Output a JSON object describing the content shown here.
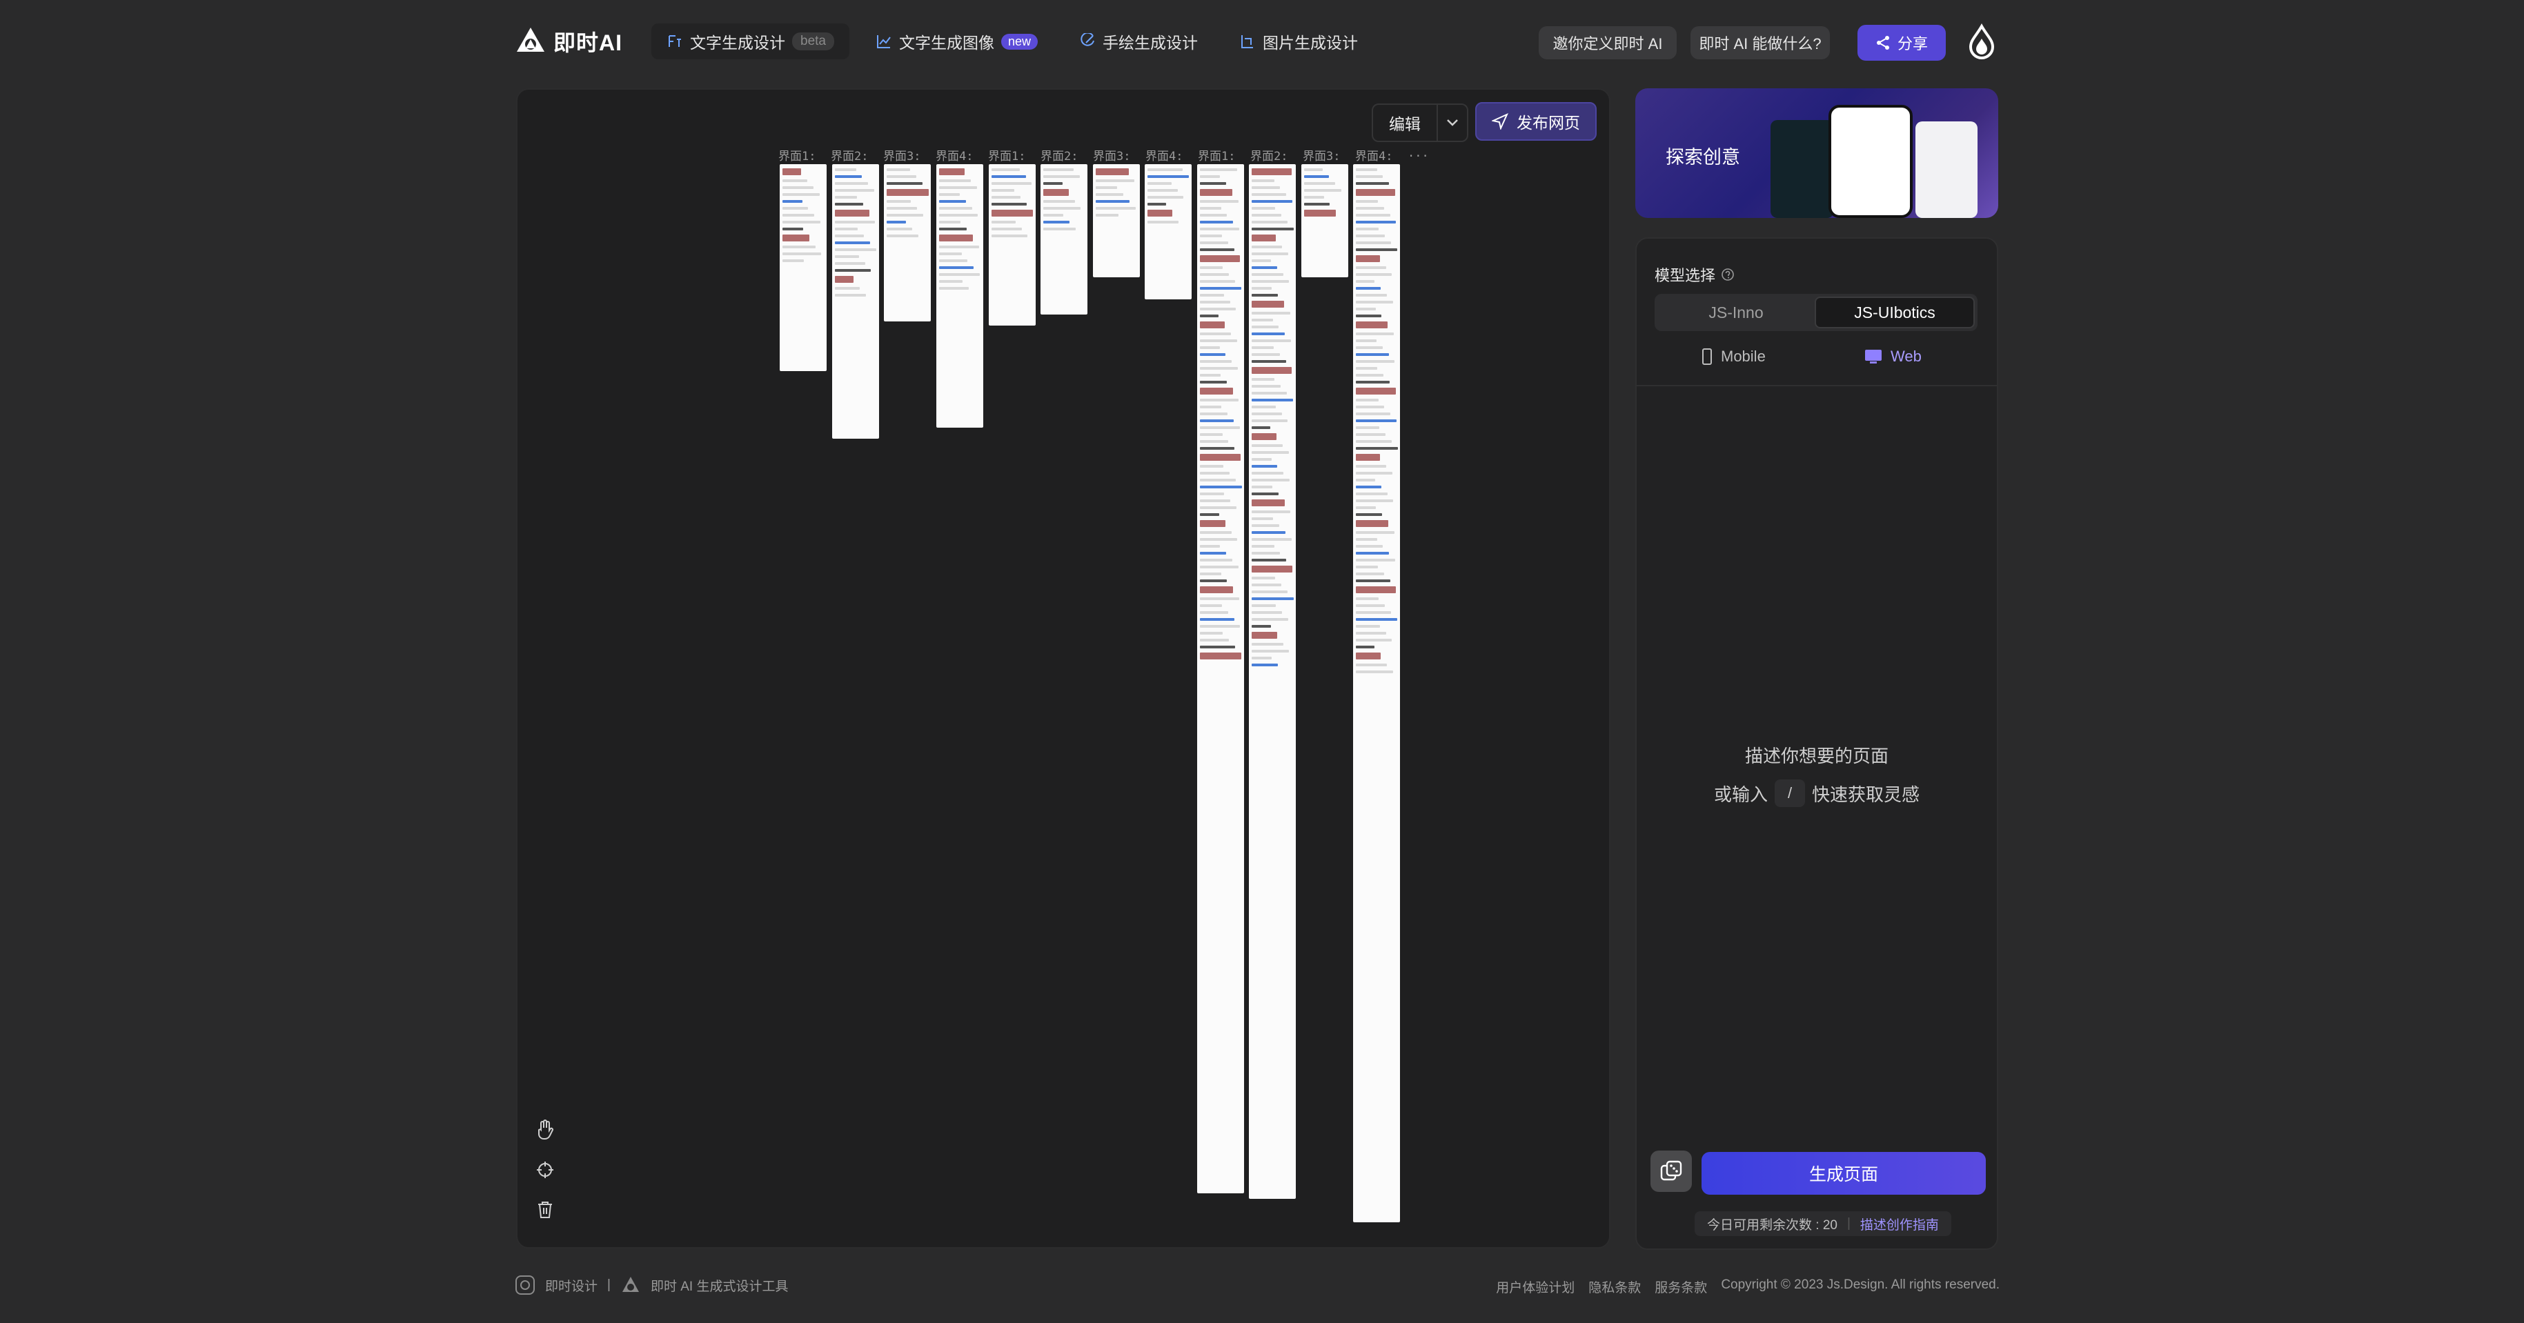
{
  "header": {
    "logo_text": "即时AI",
    "nav": [
      {
        "label": "文字生成设计",
        "badge": "beta",
        "icon": "text-design-icon",
        "active": true
      },
      {
        "label": "文字生成图像",
        "badge": "new",
        "icon": "chart-image-icon",
        "active": false
      },
      {
        "label": "手绘生成设计",
        "badge": "",
        "icon": "pencil-icon",
        "active": false
      },
      {
        "label": "图片生成设计",
        "badge": "",
        "icon": "image-design-icon",
        "active": false
      }
    ],
    "invite_label": "邀你定义即时 AI",
    "what_can_label": "即时 AI 能做什么?",
    "share_label": "分享"
  },
  "canvas": {
    "edit_label": "编辑",
    "publish_label": "发布网页",
    "frame_labels": [
      "界面1:",
      "界面2:",
      "界面3:",
      "界面4:",
      "界面1:",
      "界面2:",
      "界面3:",
      "界面4:",
      "界面1:",
      "界面2:",
      "界面3:",
      "界面4:",
      "..."
    ],
    "tools": [
      "hand-icon",
      "crosshair-icon",
      "trash-icon"
    ]
  },
  "panel": {
    "explore_title": "探索创意",
    "model_label": "模型选择",
    "models": [
      "JS-Inno",
      "JS-UIbotics"
    ],
    "selected_model": "JS-UIbotics",
    "devices": [
      "Mobile",
      "Web"
    ],
    "selected_device": "Web",
    "hint_line1": "描述你想要的页面",
    "hint_prefix": "或输入",
    "hint_key": "/",
    "hint_suffix": "快速获取灵感",
    "generate_label": "生成页面",
    "quota_text": "今日可用剩余次数 : 20",
    "quota_link": "描述创作指南"
  },
  "footer": {
    "brand": "即时设计",
    "separator": "|",
    "tagline": "即时 AI 生成式设计工具",
    "links": [
      "用户体验计划",
      "隐私条款",
      "服务条款"
    ],
    "copyright": "Copyright © 2023 Js.Design. All rights reserved."
  },
  "colors": {
    "background": "#2a2a2b",
    "canvas": "#1f1f20",
    "accent": "#5546d6",
    "link": "#9f93ff"
  }
}
